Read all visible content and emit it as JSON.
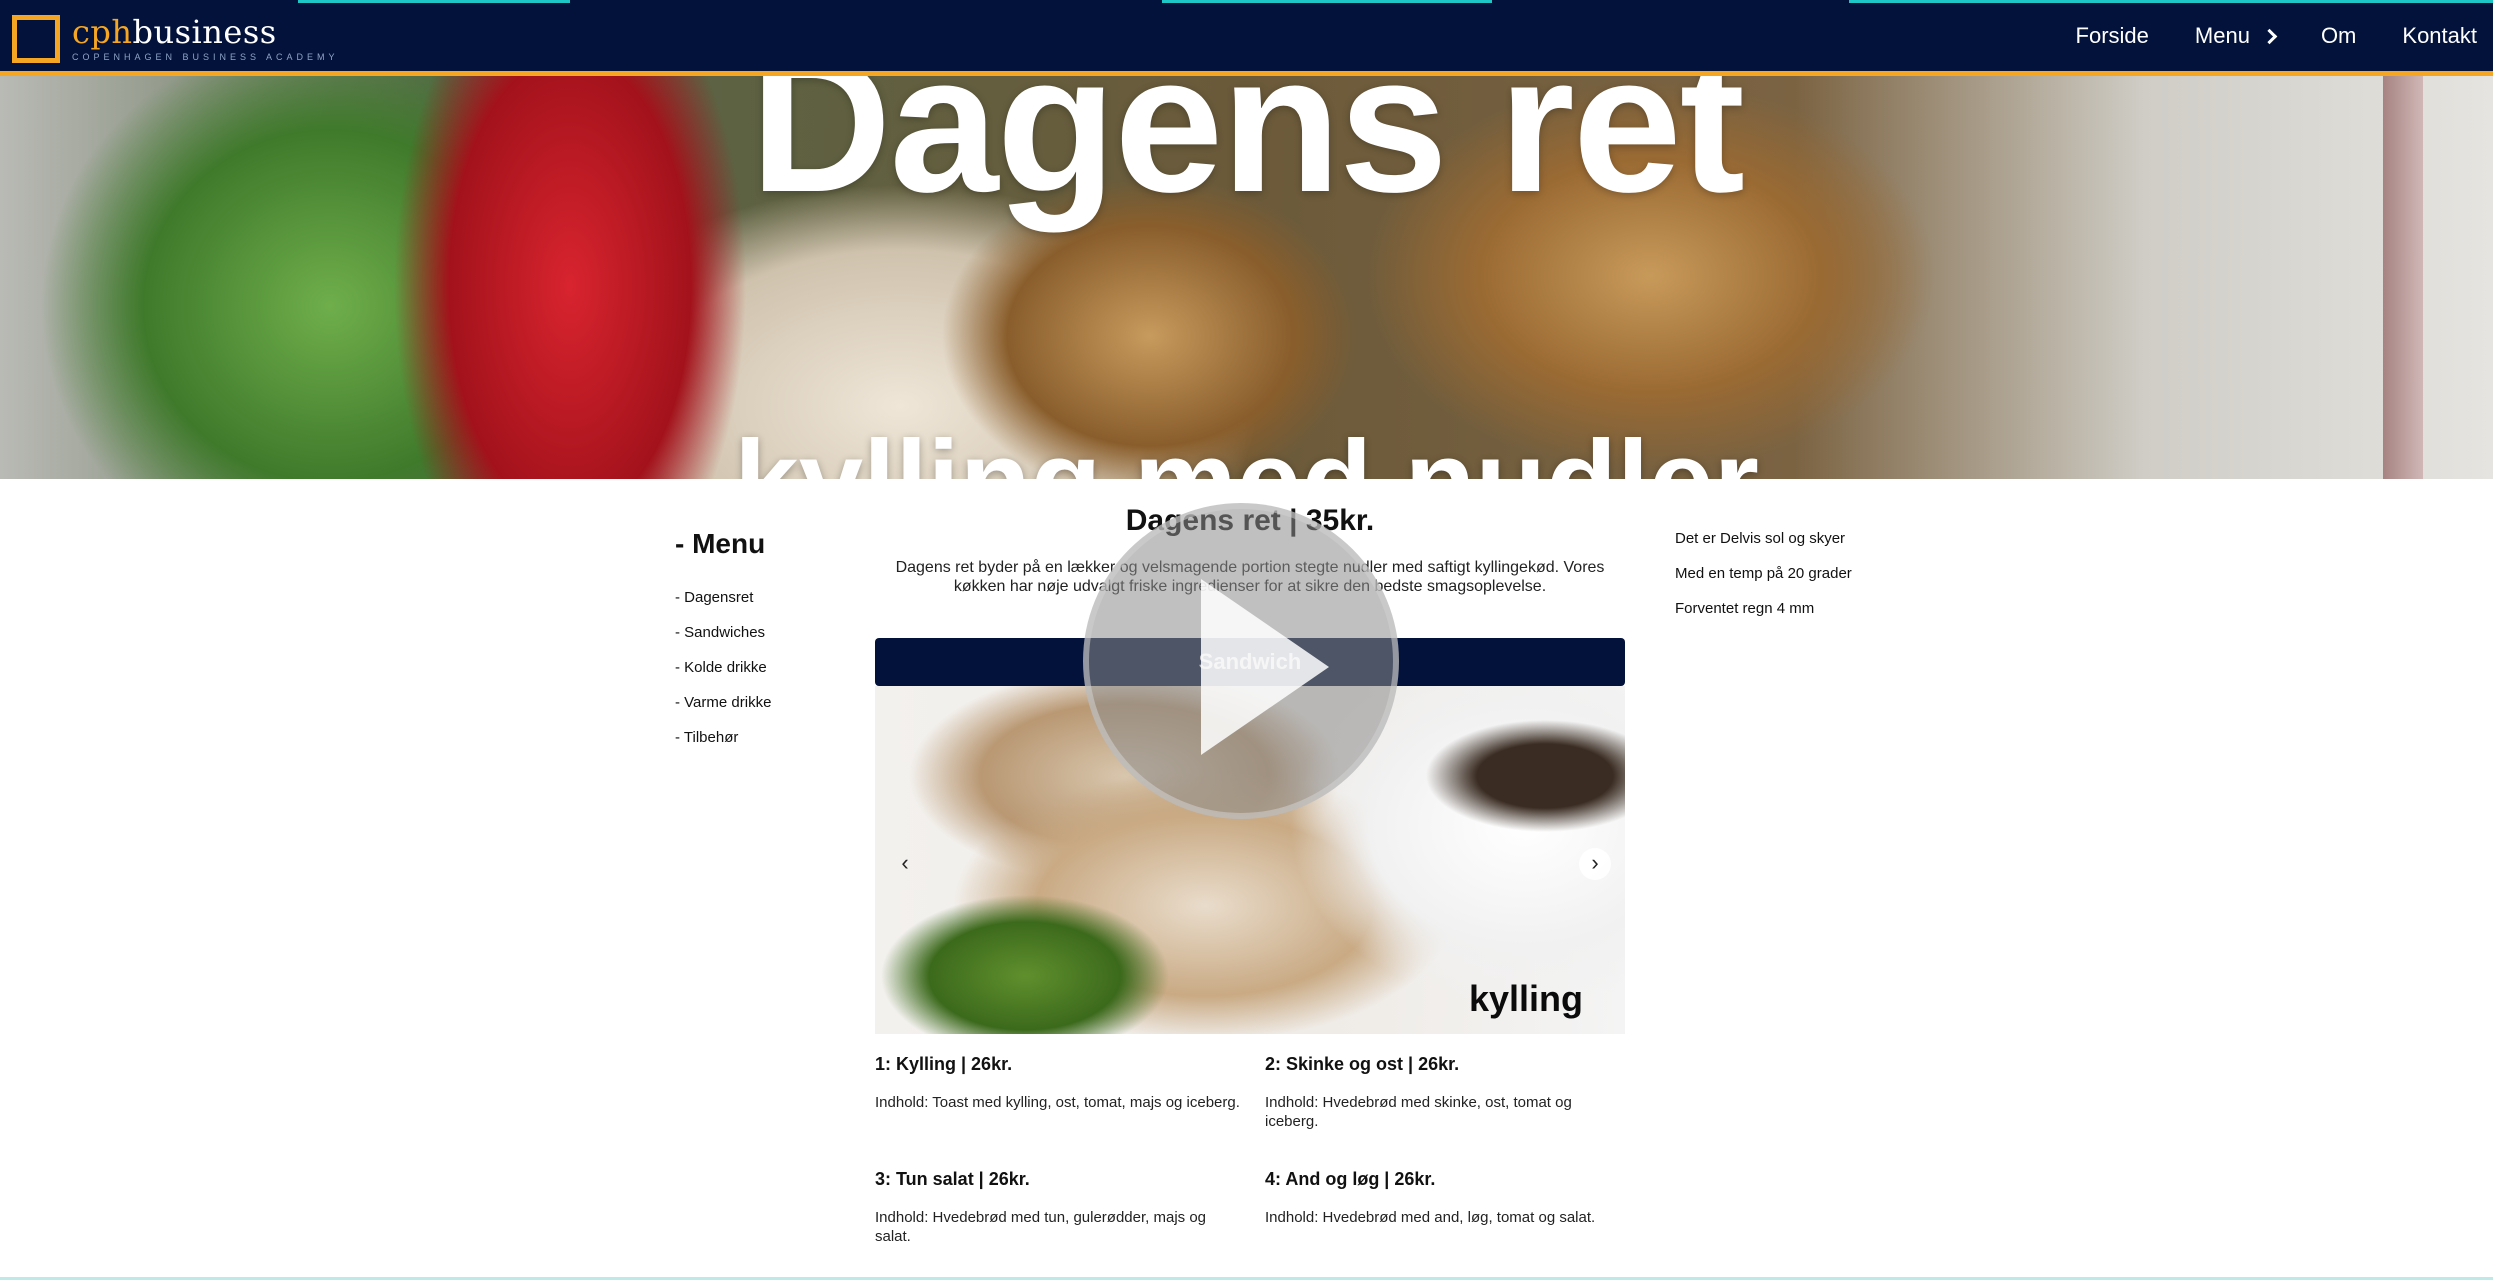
{
  "header": {
    "logo_primary": "cph",
    "logo_secondary": "business",
    "logo_tagline": "COPENHAGEN BUSINESS ACADEMY",
    "nav": [
      "Forside",
      "Menu",
      "Om",
      "Kontakt"
    ]
  },
  "hero": {
    "title": "Dagens ret",
    "subtitle": "kylling med nudler"
  },
  "side_menu": {
    "heading": "- Menu",
    "items": [
      "- Dagensret",
      "- Sandwiches",
      "- Kolde drikke",
      "- Varme drikke",
      "- Tilbehør"
    ]
  },
  "main": {
    "price_title": "Dagens ret | 35kr.",
    "intro": "Dagens ret byder på en lækker og velsmagende portion stegte nudler med saftigt kyllingekød. Vores køkken har nøje udvalgt friske ingredienser for at sikre den bedste smagsoplevelse.",
    "section_title": "Sandwich",
    "carousel": {
      "caption": "kylling",
      "prev": "‹",
      "next": "›"
    },
    "items": [
      {
        "title": "1: Kylling | 26kr.",
        "desc": "Indhold: Toast med kylling, ost, tomat, majs og iceberg."
      },
      {
        "title": "2: Skinke og ost | 26kr.",
        "desc": "Indhold: Hvedebrød med skinke, ost, tomat og iceberg."
      },
      {
        "title": "3: Tun salat | 26kr.",
        "desc": "Indhold: Hvedebrød med tun, gulerødder, majs og salat."
      },
      {
        "title": "4: And og løg | 26kr.",
        "desc": "Indhold: Hvedebrød med and, løg, tomat og salat."
      }
    ]
  },
  "weather": {
    "lines": [
      "Det er Delvis sol og skyer",
      "Med en temp på 20 grader",
      "Forventet regn 4 mm"
    ]
  },
  "colors": {
    "navy": "#03123a",
    "accent_orange": "#f5a623",
    "accent_teal": "#1fc6c6"
  }
}
